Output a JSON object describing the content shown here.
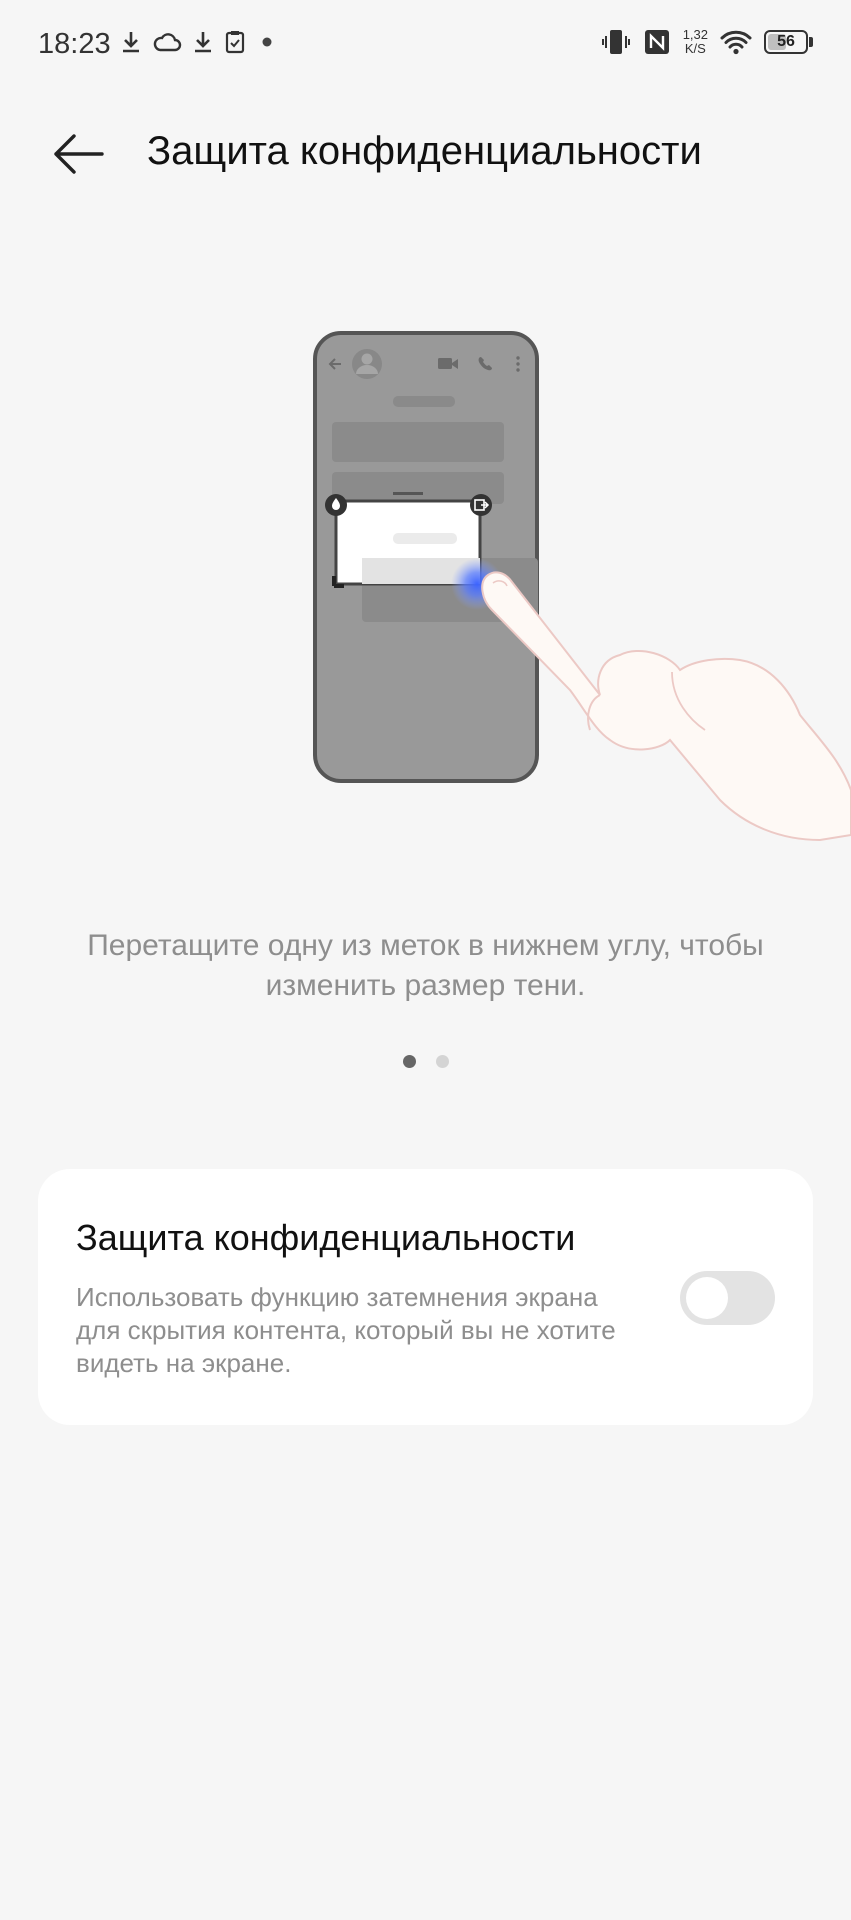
{
  "status_bar": {
    "time": "18:23",
    "net_speed_value": "1,32",
    "net_speed_unit": "K/S",
    "battery": "56",
    "battery_level": 0.56,
    "icons": [
      "download-icon",
      "cloud-icon",
      "download-icon",
      "clipboard-icon",
      "dot-icon",
      "vibrate-icon",
      "nfc-icon",
      "wifi-icon",
      "battery-icon"
    ]
  },
  "header": {
    "title": "Защита конфиденциальности",
    "back_icon": "arrow-left-icon"
  },
  "illustration": {
    "icons": [
      "phone-mockup",
      "hand-icon"
    ],
    "accent_color": "#4a6cf7"
  },
  "hint": "Перетащите одну из меток в нижнем углу, чтобы изменить размер тени.",
  "pager": {
    "total": 2,
    "active": 1
  },
  "setting": {
    "title": "Защита конфиденциальности",
    "description": "Использовать функцию затемнения экрана для скрытия контента, который вы не хотите видеть на экране.",
    "enabled": false
  }
}
